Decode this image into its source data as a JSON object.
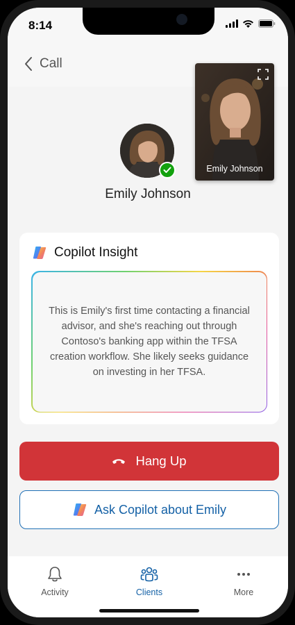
{
  "status": {
    "time": "8:14"
  },
  "header": {
    "back_label": "Call"
  },
  "self_video": {
    "name": "Emily Johnson"
  },
  "caller": {
    "name": "Emily Johnson",
    "presence": "available"
  },
  "insight": {
    "title": "Copilot Insight",
    "text": "This is Emily's first time contacting a financial advisor, and she's reaching out through Contoso's banking app within the TFSA creation workflow. She likely seeks guidance on investing in her TFSA."
  },
  "actions": {
    "hangup_label": "Hang Up",
    "ask_label": "Ask Copilot about Emily"
  },
  "nav": {
    "items": [
      {
        "label": "Activity",
        "icon": "bell-icon",
        "active": false
      },
      {
        "label": "Clients",
        "icon": "people-icon",
        "active": true
      },
      {
        "label": "More",
        "icon": "more-icon",
        "active": false
      }
    ]
  },
  "colors": {
    "hangup": "#d13438",
    "accent": "#1461a6",
    "presence": "#13a10e"
  }
}
